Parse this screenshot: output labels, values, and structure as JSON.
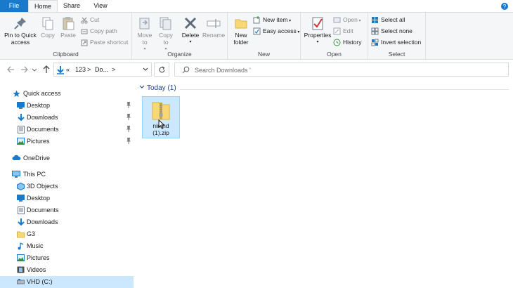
{
  "tabs": {
    "file": "File",
    "home": "Home",
    "share": "Share",
    "view": "View"
  },
  "colors": {
    "accent": "#1979ca",
    "selection": "#cce8ff",
    "folder": "#f8d775",
    "header_text": "#1e3f8b"
  },
  "ribbon": {
    "clipboard": {
      "label": "Clipboard",
      "pin": "Pin to Quick access",
      "copy": "Copy",
      "paste": "Paste",
      "cut": "Cut",
      "copy_path": "Copy path",
      "paste_shortcut": "Paste shortcut"
    },
    "organize": {
      "label": "Organize",
      "move_to": "Move to",
      "copy_to": "Copy to",
      "delete": "Delete",
      "rename": "Rename"
    },
    "new": {
      "label": "New",
      "new_folder": "New folder",
      "new_item": "New item",
      "easy_access": "Easy access"
    },
    "open": {
      "label": "Open",
      "properties": "Properties",
      "open": "Open",
      "edit": "Edit",
      "history": "History"
    },
    "select": {
      "label": "Select",
      "select_all": "Select all",
      "select_none": "Select none",
      "invert": "Invert selection"
    }
  },
  "address": {
    "crumbs": [
      "«",
      "123",
      ">",
      "Do...",
      ">"
    ],
    "search_placeholder": "Search Downloads '"
  },
  "nav": {
    "quick_access": "Quick access",
    "quick_items": [
      "Desktop",
      "Downloads",
      "Documents",
      "Pictures"
    ],
    "onedrive": "OneDrive",
    "this_pc": "This PC",
    "pc_items": [
      "3D Objects",
      "Desktop",
      "Documents",
      "Downloads",
      "G3",
      "Music",
      "Pictures",
      "Videos",
      "VHD (C:)"
    ]
  },
  "content": {
    "group_header": "Today (1)",
    "file_name_line1": "nirl  nd",
    "file_name_line2": "(1).zip"
  }
}
